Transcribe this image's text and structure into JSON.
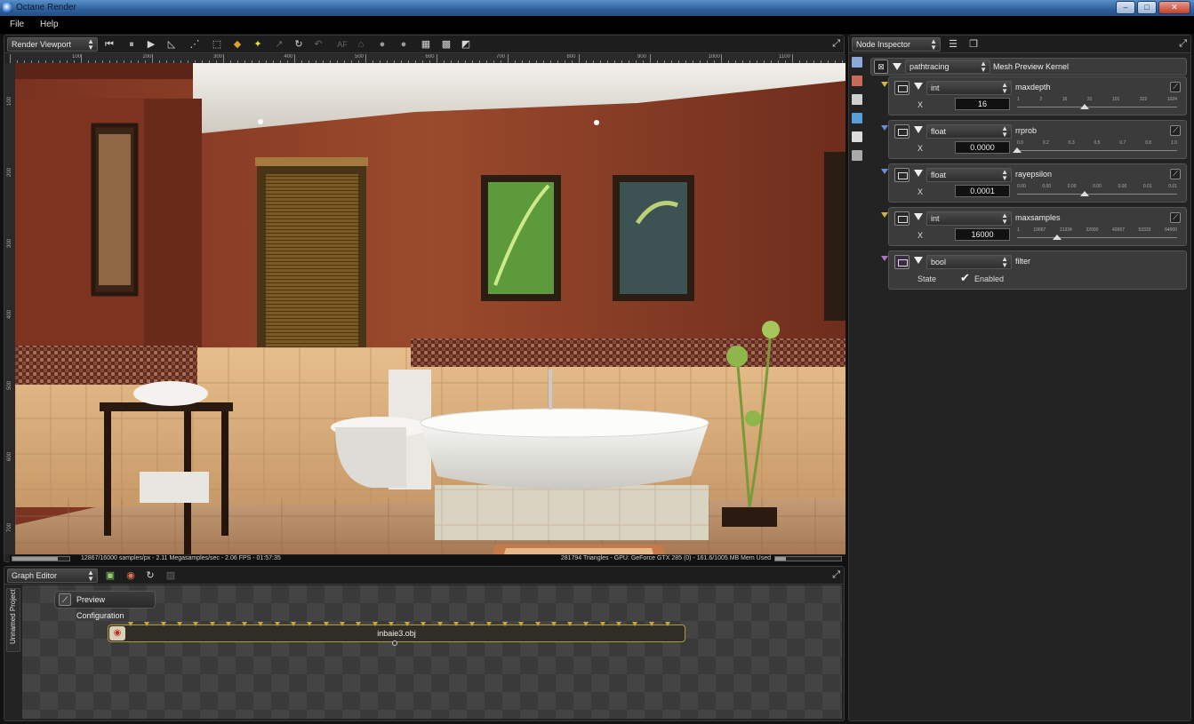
{
  "window": {
    "title": "Octane Render",
    "controls": [
      "minimize",
      "maximize",
      "close"
    ]
  },
  "menu": {
    "items": [
      "File",
      "Help"
    ]
  },
  "viewport": {
    "combo_label": "Render Viewport",
    "toolbar_icons": [
      "rewind-icon",
      "pause-icon",
      "play-icon",
      "focus-picker-icon",
      "region-icon",
      "cursor-icon",
      "color-pick-icon",
      "material-pick-icon",
      "af-icon",
      "refresh-icon",
      "undo-icon",
      "af-text-icon",
      "lock-icon",
      "sphere-icon",
      "sphere-alt-icon",
      "grid-icon",
      "checker-icon",
      "checker-alt-icon"
    ],
    "af_label": "AF",
    "ruler_top": [
      "100",
      "200",
      "300",
      "400",
      "500",
      "600",
      "700",
      "800",
      "900",
      "1000",
      "1100"
    ],
    "ruler_left": [
      "100",
      "200",
      "300",
      "400",
      "500",
      "600",
      "700"
    ],
    "status_left": "12867/16000 samples/px - 2.11 Megasamples/sec - 2.06 FPS - 01:57:35",
    "status_right": "281794 Triangles - GPU: GeForce GTX 285 (0) - 161.6/1005 MB Mem Used",
    "progress": 0.8
  },
  "graph_editor": {
    "combo_label": "Graph Editor",
    "side_tab": "Unnamed Project",
    "preview_button": "Preview Configuration",
    "node_label": "inbaie3.obj",
    "node_pin_count": 34
  },
  "inspector": {
    "combo_label": "Node Inspector",
    "kernel_combo": "pathtracing",
    "kernel_label": "Mesh Preview Kernel",
    "params": [
      {
        "type": "int",
        "name": "maxdepth",
        "axis": "X",
        "value": "16",
        "ticks": [
          "1",
          "2",
          "16",
          "31",
          "101",
          "322",
          "1024"
        ],
        "pos": 0.42,
        "color": "#d4b43a"
      },
      {
        "type": "float",
        "name": "rrprob",
        "axis": "X",
        "value": "0.0000",
        "ticks": [
          "0.0",
          "0.2",
          "0.3",
          "0.5",
          "0.7",
          "0.8",
          "1.0"
        ],
        "pos": 0.0,
        "color": "#6a8fd6"
      },
      {
        "type": "float",
        "name": "rayepsilon",
        "axis": "X",
        "value": "0.0001",
        "ticks": [
          "0.00",
          "0.00",
          "0.00",
          "0.00",
          "0.00",
          "0.01",
          "0.01"
        ],
        "pos": 0.42,
        "color": "#6a8fd6"
      },
      {
        "type": "int",
        "name": "maxsamples",
        "axis": "X",
        "value": "16000",
        "ticks": [
          "1",
          "10667",
          "21334",
          "32000",
          "42667",
          "53333",
          "64000"
        ],
        "pos": 0.25,
        "color": "#d4b43a"
      }
    ],
    "filter": {
      "type": "bool",
      "name": "filter",
      "state_label": "State",
      "enabled_label": "Enabled",
      "checked": true,
      "color": "#b070c8"
    }
  }
}
